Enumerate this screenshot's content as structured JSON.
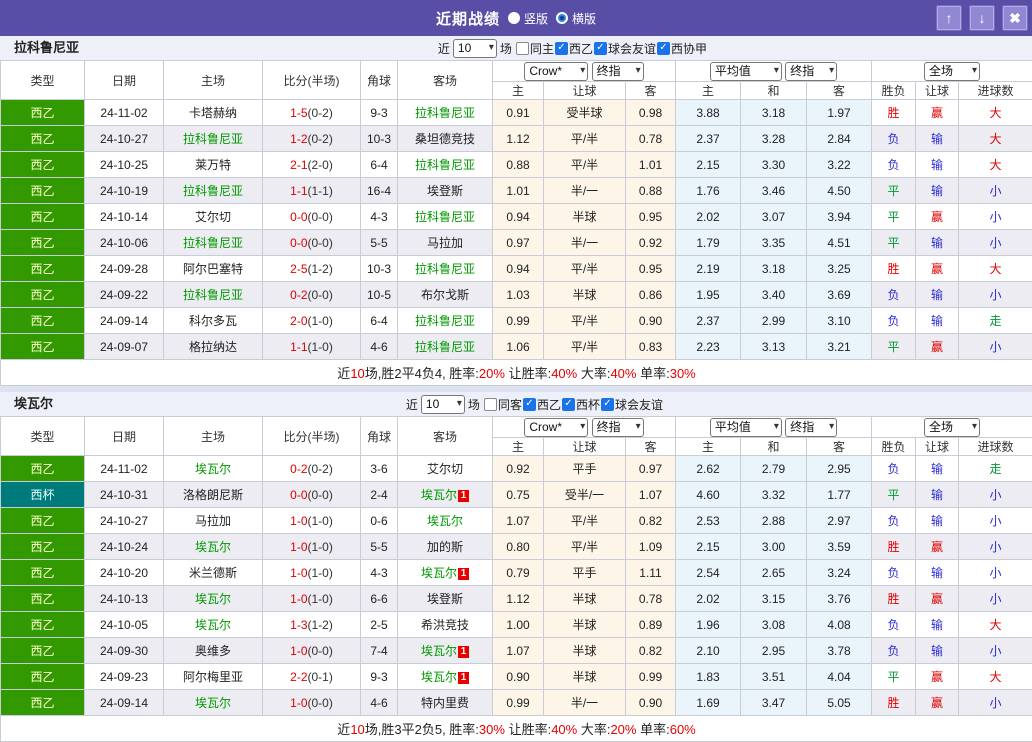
{
  "colors": {
    "titlebar_purple": "#584ea6",
    "button_purple": "#9188d4",
    "checkbox_blue": "#1a73e8",
    "league_green": "#339900",
    "cup_teal": "#007b7b",
    "focus_team_green": "#009900",
    "score_red": "#e10000",
    "win_red": "#e10000",
    "lose_blue": "#2b2bd5",
    "draw_green": "#009933",
    "handicap_col_bg": "#fcf5e8",
    "avg_col_bg": "#eaf4fb"
  },
  "titlebar": {
    "title": "近期战绩",
    "layout_options": [
      {
        "label": "竖版",
        "selected": false
      },
      {
        "label": "横版",
        "selected": true
      }
    ],
    "window_buttons": [
      {
        "name": "move-up",
        "glyph": "↑"
      },
      {
        "name": "move-down",
        "glyph": "↓"
      },
      {
        "name": "close",
        "glyph": "✖"
      }
    ]
  },
  "header": {
    "cols": [
      "类型",
      "日期",
      "主场",
      "比分(半场)",
      "角球",
      "客场"
    ],
    "sub": [
      "主",
      "让球",
      "客",
      "主",
      "和",
      "客",
      "胜负",
      "让球",
      "进球数"
    ],
    "selects": {
      "company": "Crow*",
      "company_stage": "终指",
      "avg": "平均值",
      "avg_stage": "终指",
      "scope": "全场"
    }
  },
  "result_colors": {
    "胜": "r",
    "平": "g",
    "负": "b",
    "赢": "r",
    "输": "b",
    "大": "r",
    "小": "b",
    "走": "g"
  },
  "sections": [
    {
      "team": "拉科鲁尼亚",
      "filter": {
        "prefix": "近",
        "count": "10",
        "suffix": "场",
        "checkboxes": [
          {
            "label": "同主",
            "checked": false
          },
          {
            "label": "西乙",
            "checked": true
          },
          {
            "label": "球会友谊",
            "checked": true
          },
          {
            "label": "西协甲",
            "checked": true
          }
        ]
      },
      "rows": [
        {
          "comp": "西乙",
          "comp_class": "league",
          "date": "24-11-02",
          "home": {
            "name": "卡塔赫纳"
          },
          "score": "1-5",
          "half": "(0-2)",
          "corner": "9-3",
          "away": {
            "name": "拉科鲁尼亚",
            "focus": true
          },
          "odds": [
            "0.91",
            "受半球",
            "0.98"
          ],
          "avg": [
            "3.88",
            "3.18",
            "1.97"
          ],
          "results": [
            "胜",
            "赢",
            "大"
          ]
        },
        {
          "comp": "西乙",
          "comp_class": "league",
          "date": "24-10-27",
          "home": {
            "name": "拉科鲁尼亚",
            "focus": true
          },
          "score": "1-2",
          "half": "(0-2)",
          "corner": "10-3",
          "away": {
            "name": "桑坦德竞技"
          },
          "odds": [
            "1.12",
            "平/半",
            "0.78"
          ],
          "avg": [
            "2.37",
            "3.28",
            "2.84"
          ],
          "results": [
            "负",
            "输",
            "大"
          ]
        },
        {
          "comp": "西乙",
          "comp_class": "league",
          "date": "24-10-25",
          "home": {
            "name": "莱万特"
          },
          "score": "2-1",
          "half": "(2-0)",
          "corner": "6-4",
          "away": {
            "name": "拉科鲁尼亚",
            "focus": true
          },
          "odds": [
            "0.88",
            "平/半",
            "1.01"
          ],
          "avg": [
            "2.15",
            "3.30",
            "3.22"
          ],
          "results": [
            "负",
            "输",
            "大"
          ]
        },
        {
          "comp": "西乙",
          "comp_class": "league",
          "date": "24-10-19",
          "home": {
            "name": "拉科鲁尼亚",
            "focus": true
          },
          "score": "1-1",
          "half": "(1-1)",
          "corner": "16-4",
          "away": {
            "name": "埃登斯"
          },
          "odds": [
            "1.01",
            "半/一",
            "0.88"
          ],
          "avg": [
            "1.76",
            "3.46",
            "4.50"
          ],
          "results": [
            "平",
            "输",
            "小"
          ]
        },
        {
          "comp": "西乙",
          "comp_class": "league",
          "date": "24-10-14",
          "home": {
            "name": "艾尔切"
          },
          "score": "0-0",
          "half": "(0-0)",
          "corner": "4-3",
          "away": {
            "name": "拉科鲁尼亚",
            "focus": true
          },
          "odds": [
            "0.94",
            "半球",
            "0.95"
          ],
          "avg": [
            "2.02",
            "3.07",
            "3.94"
          ],
          "results": [
            "平",
            "赢",
            "小"
          ]
        },
        {
          "comp": "西乙",
          "comp_class": "league",
          "date": "24-10-06",
          "home": {
            "name": "拉科鲁尼亚",
            "focus": true
          },
          "score": "0-0",
          "half": "(0-0)",
          "corner": "5-5",
          "away": {
            "name": "马拉加"
          },
          "odds": [
            "0.97",
            "半/一",
            "0.92"
          ],
          "avg": [
            "1.79",
            "3.35",
            "4.51"
          ],
          "results": [
            "平",
            "输",
            "小"
          ]
        },
        {
          "comp": "西乙",
          "comp_class": "league",
          "date": "24-09-28",
          "home": {
            "name": "阿尔巴塞特"
          },
          "score": "2-5",
          "half": "(1-2)",
          "corner": "10-3",
          "away": {
            "name": "拉科鲁尼亚",
            "focus": true
          },
          "odds": [
            "0.94",
            "平/半",
            "0.95"
          ],
          "avg": [
            "2.19",
            "3.18",
            "3.25"
          ],
          "results": [
            "胜",
            "赢",
            "大"
          ]
        },
        {
          "comp": "西乙",
          "comp_class": "league",
          "date": "24-09-22",
          "home": {
            "name": "拉科鲁尼亚",
            "focus": true
          },
          "score": "0-2",
          "half": "(0-0)",
          "corner": "10-5",
          "away": {
            "name": "布尔戈斯"
          },
          "odds": [
            "1.03",
            "半球",
            "0.86"
          ],
          "avg": [
            "1.95",
            "3.40",
            "3.69"
          ],
          "results": [
            "负",
            "输",
            "小"
          ]
        },
        {
          "comp": "西乙",
          "comp_class": "league",
          "date": "24-09-14",
          "home": {
            "name": "科尔多瓦"
          },
          "score": "2-0",
          "half": "(1-0)",
          "corner": "6-4",
          "away": {
            "name": "拉科鲁尼亚",
            "focus": true
          },
          "odds": [
            "0.99",
            "平/半",
            "0.90"
          ],
          "avg": [
            "2.37",
            "2.99",
            "3.10"
          ],
          "results": [
            "负",
            "输",
            "走"
          ]
        },
        {
          "comp": "西乙",
          "comp_class": "league",
          "date": "24-09-07",
          "home": {
            "name": "格拉纳达"
          },
          "score": "1-1",
          "half": "(1-0)",
          "corner": "4-6",
          "away": {
            "name": "拉科鲁尼亚",
            "focus": true
          },
          "odds": [
            "1.06",
            "平/半",
            "0.83"
          ],
          "avg": [
            "2.23",
            "3.13",
            "3.21"
          ],
          "results": [
            "平",
            "赢",
            "小"
          ]
        }
      ],
      "summary": [
        {
          "text": "近"
        },
        {
          "text": "10",
          "red": true
        },
        {
          "text": "场,胜2平4负4, 胜率:"
        },
        {
          "text": "20%",
          "red": true
        },
        {
          "text": " 让胜率:"
        },
        {
          "text": "40%",
          "red": true
        },
        {
          "text": " 大率:"
        },
        {
          "text": "40%",
          "red": true
        },
        {
          "text": " 单率:"
        },
        {
          "text": "30%",
          "red": true
        }
      ]
    },
    {
      "team": "埃瓦尔",
      "filter": {
        "prefix": "近",
        "count": "10",
        "suffix": "场",
        "checkboxes": [
          {
            "label": "同客",
            "checked": false
          },
          {
            "label": "西乙",
            "checked": true
          },
          {
            "label": "西杯",
            "checked": true
          },
          {
            "label": "球会友谊",
            "checked": true
          }
        ]
      },
      "rows": [
        {
          "comp": "西乙",
          "comp_class": "league",
          "date": "24-11-02",
          "home": {
            "name": "埃瓦尔",
            "focus": true
          },
          "score": "0-2",
          "half": "(0-2)",
          "corner": "3-6",
          "away": {
            "name": "艾尔切"
          },
          "odds": [
            "0.92",
            "平手",
            "0.97"
          ],
          "avg": [
            "2.62",
            "2.79",
            "2.95"
          ],
          "results": [
            "负",
            "输",
            "走"
          ]
        },
        {
          "comp": "西杯",
          "comp_class": "cup",
          "date": "24-10-31",
          "home": {
            "name": "洛格朗尼斯"
          },
          "score": "0-0",
          "half": "(0-0)",
          "corner": "2-4",
          "away": {
            "name": "埃瓦尔",
            "focus": true,
            "badge": "1"
          },
          "odds": [
            "0.75",
            "受半/一",
            "1.07"
          ],
          "avg": [
            "4.60",
            "3.32",
            "1.77"
          ],
          "results": [
            "平",
            "输",
            "小"
          ]
        },
        {
          "comp": "西乙",
          "comp_class": "league",
          "date": "24-10-27",
          "home": {
            "name": "马拉加"
          },
          "score": "1-0",
          "half": "(1-0)",
          "corner": "0-6",
          "away": {
            "name": "埃瓦尔",
            "focus": true
          },
          "odds": [
            "1.07",
            "平/半",
            "0.82"
          ],
          "avg": [
            "2.53",
            "2.88",
            "2.97"
          ],
          "results": [
            "负",
            "输",
            "小"
          ]
        },
        {
          "comp": "西乙",
          "comp_class": "league",
          "date": "24-10-24",
          "home": {
            "name": "埃瓦尔",
            "focus": true
          },
          "score": "1-0",
          "half": "(1-0)",
          "corner": "5-5",
          "away": {
            "name": "加的斯"
          },
          "odds": [
            "0.80",
            "平/半",
            "1.09"
          ],
          "avg": [
            "2.15",
            "3.00",
            "3.59"
          ],
          "results": [
            "胜",
            "赢",
            "小"
          ]
        },
        {
          "comp": "西乙",
          "comp_class": "league",
          "date": "24-10-20",
          "home": {
            "name": "米兰德斯"
          },
          "score": "1-0",
          "half": "(1-0)",
          "corner": "4-3",
          "away": {
            "name": "埃瓦尔",
            "focus": true,
            "badge": "1"
          },
          "odds": [
            "0.79",
            "平手",
            "1.11"
          ],
          "avg": [
            "2.54",
            "2.65",
            "3.24"
          ],
          "results": [
            "负",
            "输",
            "小"
          ]
        },
        {
          "comp": "西乙",
          "comp_class": "league",
          "date": "24-10-13",
          "home": {
            "name": "埃瓦尔",
            "focus": true
          },
          "score": "1-0",
          "half": "(1-0)",
          "corner": "6-6",
          "away": {
            "name": "埃登斯"
          },
          "odds": [
            "1.12",
            "半球",
            "0.78"
          ],
          "avg": [
            "2.02",
            "3.15",
            "3.76"
          ],
          "results": [
            "胜",
            "赢",
            "小"
          ]
        },
        {
          "comp": "西乙",
          "comp_class": "league",
          "date": "24-10-05",
          "home": {
            "name": "埃瓦尔",
            "focus": true
          },
          "score": "1-3",
          "half": "(1-2)",
          "corner": "2-5",
          "away": {
            "name": "希洪竞技"
          },
          "odds": [
            "1.00",
            "半球",
            "0.89"
          ],
          "avg": [
            "1.96",
            "3.08",
            "4.08"
          ],
          "results": [
            "负",
            "输",
            "大"
          ]
        },
        {
          "comp": "西乙",
          "comp_class": "league",
          "date": "24-09-30",
          "home": {
            "name": "奥维多"
          },
          "score": "1-0",
          "half": "(0-0)",
          "corner": "7-4",
          "away": {
            "name": "埃瓦尔",
            "focus": true,
            "badge": "1"
          },
          "odds": [
            "1.07",
            "半球",
            "0.82"
          ],
          "avg": [
            "2.10",
            "2.95",
            "3.78"
          ],
          "results": [
            "负",
            "输",
            "小"
          ]
        },
        {
          "comp": "西乙",
          "comp_class": "league",
          "date": "24-09-23",
          "home": {
            "name": "阿尔梅里亚"
          },
          "score": "2-2",
          "half": "(0-1)",
          "corner": "9-3",
          "away": {
            "name": "埃瓦尔",
            "focus": true,
            "badge": "1"
          },
          "odds": [
            "0.90",
            "半球",
            "0.99"
          ],
          "avg": [
            "1.83",
            "3.51",
            "4.04"
          ],
          "results": [
            "平",
            "赢",
            "大"
          ]
        },
        {
          "comp": "西乙",
          "comp_class": "league",
          "date": "24-09-14",
          "home": {
            "name": "埃瓦尔",
            "focus": true
          },
          "score": "1-0",
          "half": "(0-0)",
          "corner": "4-6",
          "away": {
            "name": "特内里费"
          },
          "odds": [
            "0.99",
            "半/一",
            "0.90"
          ],
          "avg": [
            "1.69",
            "3.47",
            "5.05"
          ],
          "results": [
            "胜",
            "赢",
            "小"
          ]
        }
      ],
      "summary": [
        {
          "text": "近"
        },
        {
          "text": "10",
          "red": true
        },
        {
          "text": "场,胜3平2负5, 胜率:"
        },
        {
          "text": "30%",
          "red": true
        },
        {
          "text": " 让胜率:"
        },
        {
          "text": "40%",
          "red": true
        },
        {
          "text": " 大率:"
        },
        {
          "text": "20%",
          "red": true
        },
        {
          "text": " 单率:"
        },
        {
          "text": "60%",
          "red": true
        }
      ]
    }
  ]
}
